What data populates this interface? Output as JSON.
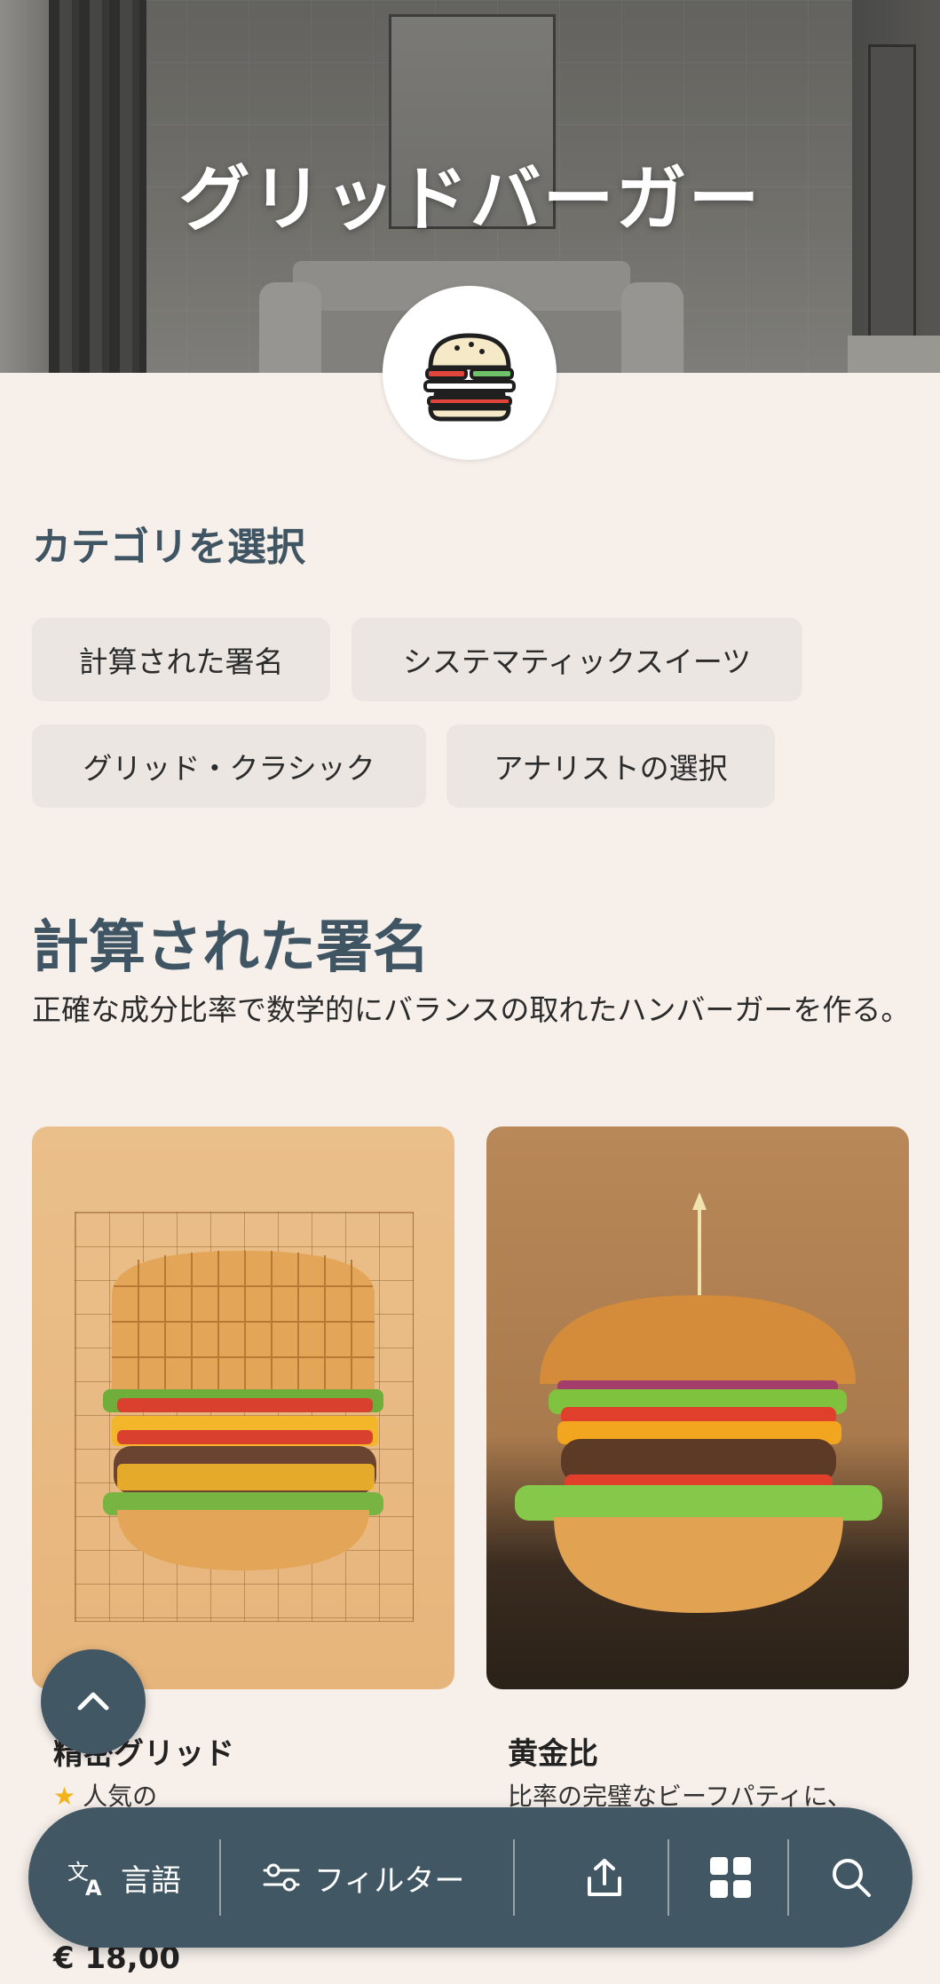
{
  "hero": {
    "title": "グリッドバーガー",
    "logo_icon": "burger-logo-icon"
  },
  "categories": {
    "title": "カテゴリを選択",
    "items": [
      {
        "label": "計算された署名"
      },
      {
        "label": "システマティックスイーツ"
      },
      {
        "label": "グリッド・クラシック"
      },
      {
        "label": "アナリストの選択"
      }
    ]
  },
  "section": {
    "title": "計算された署名",
    "description": "正確な成分比率で数学的にバランスの取れたハンバーガーを作る。"
  },
  "products": [
    {
      "name": "精密グリッド",
      "badge": "人気の",
      "price": "€ 18,00"
    },
    {
      "name": "黄金比",
      "description": "比率の完璧なビーフパティに、"
    }
  ],
  "bottom_bar": {
    "language_label": "言語",
    "filter_label": "フィルター"
  },
  "colors": {
    "accent": "#425764",
    "heading": "#3f5563",
    "background": "#f6efea",
    "chip": "#ebe6e2",
    "star": "#f2b418"
  }
}
